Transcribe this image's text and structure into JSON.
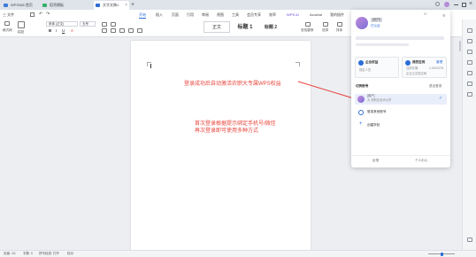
{
  "tabs": [
    {
      "label": "WPS365 首页",
      "color": "#3b7ddd"
    },
    {
      "label": "稻壳模板",
      "color": "#35b06b"
    },
    {
      "label": "文字文稿1",
      "color": "#2b6cd9"
    }
  ],
  "new_tab": "+",
  "menu": {
    "file": "三 文件",
    "items": [
      "开始",
      "插入",
      "页面",
      "引用",
      "审阅",
      "视图",
      "工具",
      "会员专享",
      "效率",
      "WPS AI",
      "Acrobat",
      "我的插件"
    ],
    "active_index": 0
  },
  "toolbar": {
    "format_painter": "格式刷",
    "paste": "粘贴",
    "font": "宋体 (正文)",
    "font_size": "五号",
    "style_body": "正文",
    "style_h1": "标题 1",
    "style_h2": "标题 2",
    "find_replace": "查找替换",
    "select": "选择",
    "sort": "排序"
  },
  "annotations": {
    "line1": "登录成功后自动激活农职大专属WPS权益",
    "line2": "首次登录根据提示绑定手机号/微信",
    "line3": "再次登录即可使用多种方式"
  },
  "panel": {
    "username": "[用户]",
    "id_label": "ID",
    "verified": "已认证",
    "card1_title": "企业权益",
    "card1_sub": "规定人员",
    "card2_title": "我的空间",
    "card2_action": "管理",
    "card2_sub1": "当前存储",
    "card2_sub2": "企业云文档空间",
    "card2_value": "1.00G/2TB",
    "account_section": "切换账号",
    "account_action": "退出登录",
    "current_account_name": "[用户]",
    "current_account_org": "大 农职业技术大学",
    "add_account": "登录其他账号",
    "create_school": "创建学校",
    "footer_left": "反馈",
    "footer_right": "个人中心"
  },
  "statusbar": {
    "page": "页面: 1/1",
    "words": "字数: 0",
    "spell": "拼写检查: 打开",
    "proof": "校对"
  },
  "colors": {
    "accent": "#2b6cd9",
    "annotation": "#e8453c",
    "arrow": "#e8453c"
  }
}
